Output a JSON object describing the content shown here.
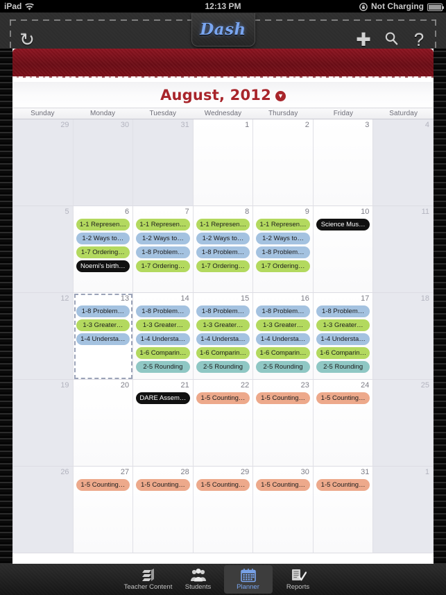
{
  "statusbar": {
    "device": "iPad",
    "wifi_icon": "wifi-icon",
    "time": "12:13 PM",
    "lock_icon": "rotation-lock-icon",
    "battery_label": "Not Charging",
    "battery_icon": "battery-icon"
  },
  "navbar": {
    "app_title": "Dash",
    "refresh_icon": "refresh-icon",
    "add_icon": "plus-icon",
    "search_icon": "search-icon",
    "help_icon": "question-mark-icon",
    "refresh_glyph": "↻",
    "add_glyph": "✚",
    "search_glyph": "⌕",
    "help_glyph": "?"
  },
  "calendar": {
    "month_title": "August, 2012",
    "chevron_glyph": "▼",
    "weekdays": [
      "Sunday",
      "Monday",
      "Tuesday",
      "Wednesday",
      "Thursday",
      "Friday",
      "Saturday"
    ],
    "accent_color": "#a8252b",
    "colors": {
      "green": "#b3d95f",
      "blue": "#a4c2e0",
      "teal": "#8fc7c4",
      "orange": "#eda98b",
      "black": "#111111"
    },
    "weeks": [
      [
        {
          "day": "29",
          "other_month": true,
          "selected": false,
          "events": []
        },
        {
          "day": "30",
          "other_month": true,
          "selected": false,
          "events": []
        },
        {
          "day": "31",
          "other_month": true,
          "selected": false,
          "events": []
        },
        {
          "day": "1",
          "other_month": false,
          "selected": false,
          "events": []
        },
        {
          "day": "2",
          "other_month": false,
          "selected": false,
          "events": []
        },
        {
          "day": "3",
          "other_month": false,
          "selected": false,
          "events": []
        },
        {
          "day": "4",
          "other_month": true,
          "selected": false,
          "events": []
        }
      ],
      [
        {
          "day": "5",
          "other_month": true,
          "selected": false,
          "events": []
        },
        {
          "day": "6",
          "other_month": false,
          "selected": false,
          "events": [
            {
              "label": "1-1 Represen…",
              "color": "green"
            },
            {
              "label": "1-2 Ways to…",
              "color": "blue"
            },
            {
              "label": "1-7 Ordering…",
              "color": "green"
            },
            {
              "label": "Noemi's birth…",
              "color": "black"
            }
          ]
        },
        {
          "day": "7",
          "other_month": false,
          "selected": false,
          "events": [
            {
              "label": "1-1 Represen…",
              "color": "green"
            },
            {
              "label": "1-2 Ways to…",
              "color": "blue"
            },
            {
              "label": "1-8 Problem…",
              "color": "blue"
            },
            {
              "label": "1-7 Ordering…",
              "color": "green"
            }
          ]
        },
        {
          "day": "8",
          "other_month": false,
          "selected": false,
          "events": [
            {
              "label": "1-1 Represen…",
              "color": "green"
            },
            {
              "label": "1-2 Ways to…",
              "color": "blue"
            },
            {
              "label": "1-8 Problem…",
              "color": "blue"
            },
            {
              "label": "1-7 Ordering…",
              "color": "green"
            }
          ]
        },
        {
          "day": "9",
          "other_month": false,
          "selected": false,
          "events": [
            {
              "label": "1-1 Represen…",
              "color": "green"
            },
            {
              "label": "1-2 Ways to…",
              "color": "blue"
            },
            {
              "label": "1-8 Problem…",
              "color": "blue"
            },
            {
              "label": "1-7 Ordering…",
              "color": "green"
            }
          ]
        },
        {
          "day": "10",
          "other_month": false,
          "selected": false,
          "events": [
            {
              "label": "Science Mus…",
              "color": "black"
            }
          ]
        },
        {
          "day": "11",
          "other_month": true,
          "selected": false,
          "events": []
        }
      ],
      [
        {
          "day": "12",
          "other_month": true,
          "selected": false,
          "events": []
        },
        {
          "day": "13",
          "other_month": false,
          "selected": true,
          "events": [
            {
              "label": "1-8 Problem…",
              "color": "blue"
            },
            {
              "label": "1-3 Greater…",
              "color": "green"
            },
            {
              "label": "1-4 Understa…",
              "color": "blue"
            }
          ]
        },
        {
          "day": "14",
          "other_month": false,
          "selected": false,
          "events": [
            {
              "label": "1-8 Problem…",
              "color": "blue"
            },
            {
              "label": "1-3 Greater…",
              "color": "green"
            },
            {
              "label": "1-4 Understa…",
              "color": "blue"
            },
            {
              "label": "1-6 Comparin…",
              "color": "green"
            },
            {
              "label": "2-5 Rounding",
              "color": "teal"
            }
          ]
        },
        {
          "day": "15",
          "other_month": false,
          "selected": false,
          "events": [
            {
              "label": "1-8 Problem…",
              "color": "blue"
            },
            {
              "label": "1-3 Greater…",
              "color": "green"
            },
            {
              "label": "1-4 Understa…",
              "color": "blue"
            },
            {
              "label": "1-6 Comparin…",
              "color": "green"
            },
            {
              "label": "2-5 Rounding",
              "color": "teal"
            }
          ]
        },
        {
          "day": "16",
          "other_month": false,
          "selected": false,
          "events": [
            {
              "label": "1-8 Problem…",
              "color": "blue"
            },
            {
              "label": "1-3 Greater…",
              "color": "green"
            },
            {
              "label": "1-4 Understa…",
              "color": "blue"
            },
            {
              "label": "1-6 Comparin…",
              "color": "green"
            },
            {
              "label": "2-5 Rounding",
              "color": "teal"
            }
          ]
        },
        {
          "day": "17",
          "other_month": false,
          "selected": false,
          "events": [
            {
              "label": "1-8 Problem…",
              "color": "blue"
            },
            {
              "label": "1-3 Greater…",
              "color": "green"
            },
            {
              "label": "1-4 Understa…",
              "color": "blue"
            },
            {
              "label": "1-6 Comparin…",
              "color": "green"
            },
            {
              "label": "2-5 Rounding",
              "color": "teal"
            }
          ]
        },
        {
          "day": "18",
          "other_month": true,
          "selected": false,
          "events": []
        }
      ],
      [
        {
          "day": "19",
          "other_month": true,
          "selected": false,
          "events": []
        },
        {
          "day": "20",
          "other_month": false,
          "selected": false,
          "events": []
        },
        {
          "day": "21",
          "other_month": false,
          "selected": false,
          "events": [
            {
              "label": "DARE Assem…",
              "color": "black"
            }
          ]
        },
        {
          "day": "22",
          "other_month": false,
          "selected": false,
          "events": [
            {
              "label": "1-5 Counting…",
              "color": "orange"
            }
          ]
        },
        {
          "day": "23",
          "other_month": false,
          "selected": false,
          "events": [
            {
              "label": "1-5 Counting…",
              "color": "orange"
            }
          ]
        },
        {
          "day": "24",
          "other_month": false,
          "selected": false,
          "events": [
            {
              "label": "1-5 Counting…",
              "color": "orange"
            }
          ]
        },
        {
          "day": "25",
          "other_month": true,
          "selected": false,
          "events": []
        }
      ],
      [
        {
          "day": "26",
          "other_month": true,
          "selected": false,
          "events": []
        },
        {
          "day": "27",
          "other_month": false,
          "selected": false,
          "events": [
            {
              "label": "1-5 Counting…",
              "color": "orange"
            }
          ]
        },
        {
          "day": "28",
          "other_month": false,
          "selected": false,
          "events": [
            {
              "label": "1-5 Counting…",
              "color": "orange"
            }
          ]
        },
        {
          "day": "29",
          "other_month": false,
          "selected": false,
          "events": [
            {
              "label": "1-5 Counting…",
              "color": "orange"
            }
          ]
        },
        {
          "day": "30",
          "other_month": false,
          "selected": false,
          "events": [
            {
              "label": "1-5 Counting…",
              "color": "orange"
            }
          ]
        },
        {
          "day": "31",
          "other_month": false,
          "selected": false,
          "events": [
            {
              "label": "1-5 Counting…",
              "color": "orange"
            }
          ]
        },
        {
          "day": "1",
          "other_month": true,
          "selected": false,
          "events": []
        }
      ]
    ]
  },
  "tabbar": {
    "items": [
      {
        "label": "Teacher Content",
        "icon": "books-icon",
        "active": false
      },
      {
        "label": "Students",
        "icon": "people-icon",
        "active": false
      },
      {
        "label": "Planner",
        "icon": "calendar-icon",
        "active": true
      },
      {
        "label": "Reports",
        "icon": "report-check-icon",
        "active": false
      }
    ]
  }
}
